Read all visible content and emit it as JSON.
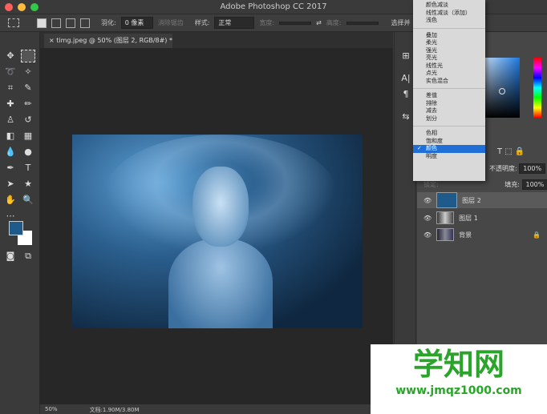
{
  "window": {
    "title": "Adobe Photoshop CC 2017"
  },
  "options": {
    "feather_label": "羽化:",
    "feather_value": "0 像素",
    "antialias": "消除锯齿",
    "style_label": "样式:",
    "style_value": "正常",
    "width_label": "宽度:",
    "height_label": "高度:",
    "select_mask": "选择并"
  },
  "tab": {
    "label": "timg.jpeg @ 50% (图层 2, RGB/8#) *"
  },
  "status": {
    "zoom": "50%",
    "doc": "文档:1.90M/3.80M"
  },
  "blend_menu": {
    "items": [
      [
        "颜色减淡",
        "线性减淡（添加）",
        "浅色"
      ],
      [
        "叠加",
        "柔光",
        "强光",
        "亮光",
        "线性光",
        "点光",
        "实色混合"
      ],
      [
        "差值",
        "排除",
        "减去",
        "划分"
      ],
      [
        "色相",
        "饱和度",
        "颜色",
        "明度"
      ]
    ],
    "selected": "颜色"
  },
  "layers_panel": {
    "opacity_label": "不透明度:",
    "opacity": "100%",
    "lock_label": "锁定:",
    "fill_label": "填充:",
    "fill": "100%",
    "layers": [
      {
        "name": "图层 2",
        "color": "#1e5a8a"
      },
      {
        "name": "图层 1"
      },
      {
        "name": "背景"
      }
    ]
  },
  "watermark": {
    "title": "学知网",
    "url": "www.jmqz1000.com"
  }
}
